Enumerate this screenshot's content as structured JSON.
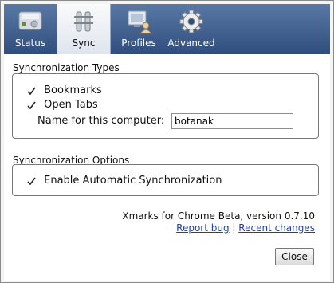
{
  "tabs": [
    {
      "label": "Status",
      "icon": "disk-icon"
    },
    {
      "label": "Sync",
      "icon": "sync-tools-icon"
    },
    {
      "label": "Profiles",
      "icon": "profiles-icon"
    },
    {
      "label": "Advanced",
      "icon": "gear-icon"
    }
  ],
  "active_tab": "Sync",
  "sync_types": {
    "title": "Synchronization Types",
    "bookmarks_label": "Bookmarks",
    "bookmarks_checked": true,
    "open_tabs_label": "Open Tabs",
    "open_tabs_checked": true,
    "computer_name_label": "Name for this computer:",
    "computer_name_value": "botanak"
  },
  "sync_options": {
    "title": "Synchronization Options",
    "auto_sync_label": "Enable Automatic Synchronization",
    "auto_sync_checked": true
  },
  "footer": {
    "version_text": "Xmarks for Chrome Beta, version 0.7.10",
    "report_bug": "Report bug",
    "separator": "|",
    "recent_changes": "Recent changes",
    "close_label": "Close"
  },
  "colors": {
    "toolbar_top": "#5a78a4",
    "toolbar_bottom": "#2f4e7e",
    "link": "#1b3fb8"
  }
}
